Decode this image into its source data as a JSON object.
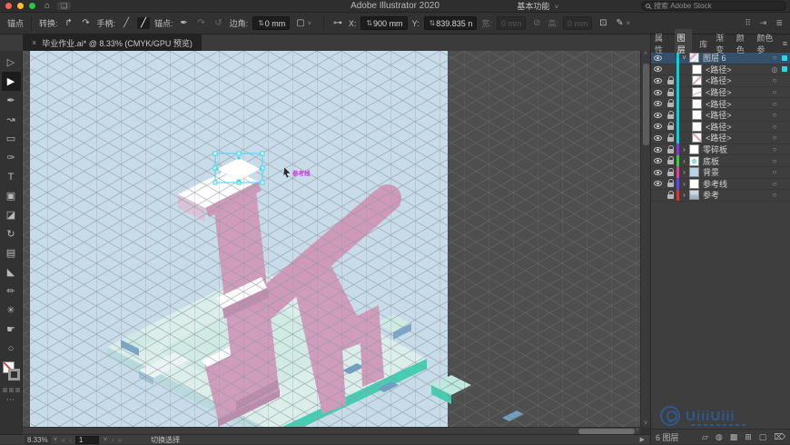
{
  "titlebar": {
    "title": "Adobe Illustrator 2020",
    "workspace": "基本功能",
    "search_placeholder": "搜索 Adobe Stock"
  },
  "controlbar": {
    "left_label": "锚点",
    "convert_label": "转换:",
    "handles_label": "手柄:",
    "anchors_label": "锚点:",
    "corner_label": "边角:",
    "corner_value": "0 mm",
    "x_label": "X:",
    "x_value": "900 mm",
    "y_label": "Y:",
    "y_value": "839.835 n",
    "width_label": "宽:",
    "width_value": "0 mm",
    "height_label": "高:",
    "height_value": "0 mm"
  },
  "doc_tab": {
    "close": "×",
    "title": "毕业作业.ai* @ 8.33% (CMYK/GPU 预览)"
  },
  "tools": [
    {
      "name": "selection",
      "glyph": "▷"
    },
    {
      "name": "direct-selection",
      "glyph": "▶"
    },
    {
      "name": "pen",
      "glyph": "✒"
    },
    {
      "name": "curvature",
      "glyph": "↝"
    },
    {
      "name": "rectangle",
      "glyph": "▭"
    },
    {
      "name": "paintbrush",
      "glyph": "✑"
    },
    {
      "name": "type",
      "glyph": "T"
    },
    {
      "name": "artboard",
      "glyph": "▣"
    },
    {
      "name": "eraser",
      "glyph": "◪"
    },
    {
      "name": "rotate",
      "glyph": "↻"
    },
    {
      "name": "gradient",
      "glyph": "▤"
    },
    {
      "name": "eyedropper",
      "glyph": "◣"
    },
    {
      "name": "pencil",
      "glyph": "✏"
    },
    {
      "name": "symbol-sprayer",
      "glyph": "✳"
    },
    {
      "name": "hand",
      "glyph": "☛"
    },
    {
      "name": "zoom",
      "glyph": "○"
    }
  ],
  "icons": {
    "home": "⌂",
    "layout": "❏",
    "chevron_down": "˅",
    "chevron_right": "›",
    "stepper": "⇅",
    "convert_corner": "↱",
    "convert_smooth": "↷",
    "handle_a": "╱",
    "handle_b": "╱",
    "anchor_pen": "✒",
    "anchor_arc1": "↷",
    "anchor_arc2": "↺",
    "dash_box": "▢",
    "ref_point": "⊶",
    "link_broken": "⊘",
    "transform": "⊡",
    "stylus": "✎",
    "grid_dots": "⠿",
    "distribute": "⇥",
    "list": "≣",
    "nav_first": "«",
    "nav_prev": "‹",
    "nav_next": "›",
    "nav_last": "»",
    "play": "▶",
    "scroll_up": "˄",
    "scroll_down": "˅",
    "target": "○",
    "target_active": "◎",
    "export": "▱",
    "locate": "◍",
    "mask": "▩",
    "sublayer": "⊞",
    "new_layer": "▢",
    "delete": "⌦",
    "menu": "≡",
    "more": "⋯"
  },
  "canvas": {
    "selection_label": "参考线"
  },
  "panel": {
    "tabs": [
      "属性",
      "图层",
      "库",
      "渐变",
      "颜色",
      "颜色参"
    ],
    "active_tab": "图层",
    "layers": [
      {
        "name": "图层 6",
        "color": "#00d4e0",
        "thumb": "art"
      },
      {
        "name": "<路径>",
        "color": "#00d4e0",
        "thumb": "white"
      },
      {
        "name": "<路径>",
        "color": "#00d4e0",
        "thumb": "pink1"
      },
      {
        "name": "<路径>",
        "color": "#00d4e0",
        "thumb": "pink2"
      },
      {
        "name": "<路径>",
        "color": "#00d4e0",
        "thumb": "faint"
      },
      {
        "name": "<路径>",
        "color": "#00d4e0",
        "thumb": "faint"
      },
      {
        "name": "<路径>",
        "color": "#00d4e0",
        "thumb": "faint"
      },
      {
        "name": "<路径>",
        "color": "#00d4e0",
        "thumb": "pink3"
      },
      {
        "name": "零碎板",
        "color": "#8a36e0",
        "thumb": "white"
      },
      {
        "name": "底板",
        "color": "#2fd32f",
        "thumb": "cyan"
      },
      {
        "name": "背景",
        "color": "#ea3aa0",
        "thumb": "blue"
      },
      {
        "name": "参考线",
        "color": "#5a46ec",
        "thumb": "white"
      },
      {
        "name": "参考",
        "color": "#e23030",
        "thumb": "image"
      }
    ],
    "footer_count": "6 图层"
  },
  "statusbar": {
    "zoom": "8.33%",
    "artboard_value": "1",
    "hint": "切换选择"
  },
  "watermark": {
    "text": "UiiiUiii"
  }
}
